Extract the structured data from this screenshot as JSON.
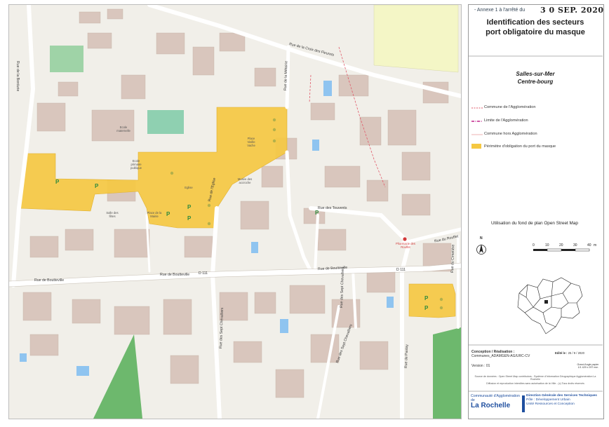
{
  "header": {
    "annex_label": "- Annexe 1 à l'arrêté du",
    "date_handwritten": "3 0 SEP. 2020",
    "title_line1": "Identification des secteurs",
    "title_line2": "port obligatoire du masque"
  },
  "place": {
    "line1": "Salles-sur-Mer",
    "line2": "Centre-bourg"
  },
  "legend": {
    "items": [
      {
        "label": "Commune de l'Agglomération",
        "color": "#e05a6a",
        "style": "dashed"
      },
      {
        "label": "Limite de l'Agglomération",
        "color": "#c0208a",
        "style": "dashdot"
      },
      {
        "label": "Commune hors Agglomération",
        "color": "#e8a0a0",
        "style": "solid"
      },
      {
        "label": "Périmètre d'obligation du port du masque",
        "color": "#f5c842",
        "style": "fill"
      }
    ]
  },
  "osm_note": "Utilisation du fond de plan Open Street Map",
  "scale": {
    "ticks": [
      "0",
      "10",
      "20",
      "30",
      "40"
    ],
    "unit": "m",
    "north": "N"
  },
  "meta": {
    "conception_label": "Conception / Réalisation :",
    "conception_value": "Communes_ADAMGEN-AG/URC-CV",
    "version": "Version : 01",
    "edited_label": "Edité le :",
    "edited_value": "25 / 9 / 2020",
    "format": "Grand Angle papier 1/1 429 x 297 mm",
    "sources": "Source de données : Open Street Map contributors - Système d'Information Géographique Agglomération La Rochelle",
    "reproduction": "Diffusion et reproduction interdites sans autorisation de la Ville - (c) Tous droits réservés"
  },
  "footer": {
    "org_line1": "Communauté d'Agglomération de",
    "org_line2": "La Rochelle",
    "dir_line1": "Direction Générale des Services Techniques",
    "dir_line2": "Pôle : Développement Urbain",
    "dir_line3": "Unité Ressources et Conception"
  },
  "map_labels": {
    "rue_bordurie": "Rue de la Bordurie",
    "rue_croix_fleurets": "Rue de la Croix des Fleurets",
    "rue_metairie": "Rue de la Métairie",
    "rue_touvents": "Rue des Touvents",
    "rue_boutteville_left": "Rue de Boutteville",
    "rue_boutteville_mid": "Rue de Boutteville",
    "rue_boutteville_right": "Rue de Boutteville",
    "rue_sept_chevalliers": "Rue des Sept Chevalliers",
    "rue_sept_chevalliers2": "Rue des Sept Chevalliers",
    "rue_sept_chevalliers3": "Rue des Sept Chevalliers",
    "rue_pastay": "Rue de Pastay",
    "rue_rouffet": "Rue du Rouffet",
    "rue_cimetiere": "Rue du Cimetière",
    "rue_eglise": "Rue de l'Eglise",
    "ecole_maternelle": "Ecole maternelle",
    "ecole_primaire": "Ecole primaire publique",
    "salle_des_fetes": "Salle des fêtes",
    "place_mairie": "Place de la Mairie",
    "place_vieille": "Place Vieille Vache",
    "musee": "Musée des accroche",
    "pharmacie": "Pharmacie des Rouffet",
    "eglise": "Eglise",
    "d111a": "D 111",
    "d111b": "D 111",
    "parking": "P"
  }
}
